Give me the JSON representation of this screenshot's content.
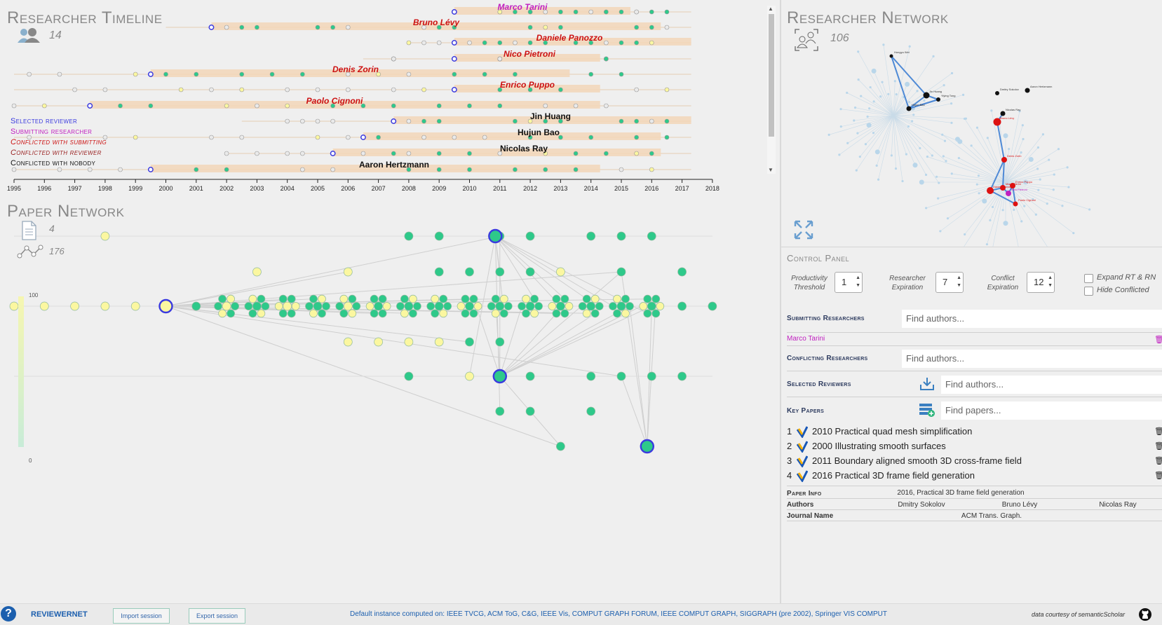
{
  "timeline": {
    "title": "Researcher Timeline",
    "researcher_count": "14",
    "researchers": [
      {
        "name": "Marco Tarini",
        "status": "submitting",
        "color": "#c020c0"
      },
      {
        "name": "Bruno Lévy",
        "status": "conflicted-submitting",
        "color": "#cc1111"
      },
      {
        "name": "Daniele Panozzo",
        "status": "conflicted-submitting",
        "color": "#cc1111"
      },
      {
        "name": "Nico Pietroni",
        "status": "conflicted-submitting",
        "color": "#cc1111"
      },
      {
        "name": "Denis Zorin",
        "status": "conflicted-submitting",
        "color": "#cc1111"
      },
      {
        "name": "Enrico Puppo",
        "status": "conflicted-submitting",
        "color": "#cc1111"
      },
      {
        "name": "Paolo Cignoni",
        "status": "conflicted-submitting",
        "color": "#cc1111"
      },
      {
        "name": "Jin Huang",
        "status": "nobody",
        "color": "#111111"
      },
      {
        "name": "Hujun Bao",
        "status": "nobody",
        "color": "#111111"
      },
      {
        "name": "Nicolas Ray",
        "status": "nobody",
        "color": "#111111"
      },
      {
        "name": "Aaron Hertzmann",
        "status": "nobody",
        "color": "#111111"
      }
    ],
    "legend": [
      {
        "label": "Selected reviewer",
        "color": "#3a3adf"
      },
      {
        "label": "Submitting researcher",
        "color": "#c020c0"
      },
      {
        "label": "Conflicted with submitting",
        "color": "#cc1111"
      },
      {
        "label": "Conflicted with reviewer",
        "color": "#9a2222"
      },
      {
        "label": "Conflicted with nobody",
        "color": "#111111"
      }
    ],
    "years": [
      "1995",
      "1996",
      "1997",
      "1998",
      "1999",
      "2000",
      "2001",
      "2002",
      "2003",
      "2004",
      "2005",
      "2006",
      "2007",
      "2008",
      "2009",
      "2010",
      "2011",
      "2012",
      "2013",
      "2014",
      "2015",
      "2016",
      "2017",
      "2018"
    ]
  },
  "paper_network": {
    "title": "Paper Network",
    "key_paper_count": "4",
    "edge_count": "176",
    "scale_max": "100",
    "scale_min": "0"
  },
  "researcher_network": {
    "title": "Researcher Network",
    "count": "106",
    "node_labels": [
      "Hongyu Wei",
      "Jin Huang",
      "Yiying Tong",
      "Hujun Bao",
      "Dmitry Sokolov",
      "Nicolas Ray",
      "Aaron Hertzmann",
      "Bruno Lévy",
      "Denis Zorin",
      "Daniele Panozzo",
      "Marco Tarini",
      "Nico Pietroni",
      "Enrico Puppo",
      "Paolo Cignoni"
    ]
  },
  "control_panel": {
    "title": "Control Panel",
    "productivity_threshold_label": "Productivity Threshold",
    "productivity_threshold_value": "1",
    "researcher_expiration_label": "Researcher Expiration",
    "researcher_expiration_value": "7",
    "conflict_expiration_label": "Conflict Expiration",
    "conflict_expiration_value": "12",
    "expand_label": "Expand RT & RN",
    "hide_label": "Hide Conflicted",
    "submitting_label": "Submitting Researchers",
    "submitting_placeholder": "Find authors...",
    "submitting_selected": "Marco Tarini",
    "conflicting_label": "Conflicting Researchers",
    "conflicting_placeholder": "Find authors...",
    "reviewers_label": "Selected Reviewers",
    "reviewers_placeholder": "Find authors...",
    "key_papers_label": "Key Papers",
    "key_papers_placeholder": "Find papers...",
    "key_papers": [
      {
        "num": "1",
        "title": "2010 Practical quad mesh simplification"
      },
      {
        "num": "2",
        "title": "2000 Illustrating smooth surfaces"
      },
      {
        "num": "3",
        "title": "2011 Boundary aligned smooth 3D cross-frame field"
      },
      {
        "num": "4",
        "title": "2016 Practical 3D frame field generation"
      }
    ],
    "paper_info_label": "Paper Info",
    "paper_info_value": "2016, Practical 3D frame field generation",
    "authors_label": "Authors",
    "authors": [
      "Dmitry Sokolov",
      "Bruno Lévy",
      "Nicolas Ray"
    ],
    "journal_label": "Journal Name",
    "journal_value": "ACM Trans. Graph."
  },
  "footer": {
    "help_glyph": "?",
    "app_name": "REVIEWERNET",
    "import_label": "Import session",
    "export_label": "Export session",
    "instance_text": "Default instance computed on: IEEE TVCG, ACM ToG, C&G, IEEE Vis, COMPUT GRAPH FORUM, IEEE COMPUT GRAPH, SIGGRAPH (pre 2002), Springer VIS COMPUT",
    "courtesy_text": "data courtesy of semanticScholar"
  },
  "colors": {
    "green": "#2ec98a",
    "yellow": "#fbf7a0",
    "blue": "#3a3adf",
    "band": "#f2d6b8"
  }
}
